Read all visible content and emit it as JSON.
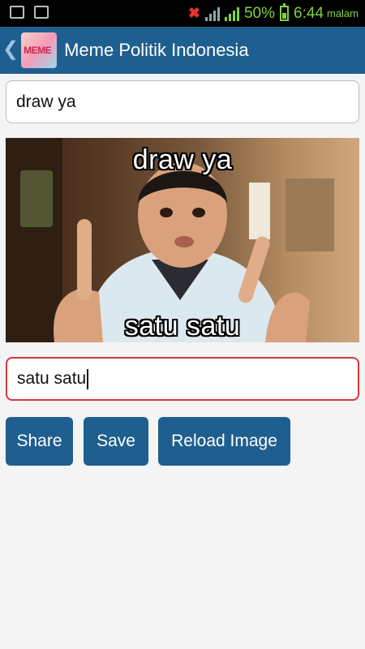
{
  "status_bar": {
    "battery_percent": "50%",
    "time": "6:44",
    "time_suffix": "malam"
  },
  "action_bar": {
    "title": "Meme Politik Indonesia",
    "logo_text": "MEME"
  },
  "top_text": {
    "value": "draw ya"
  },
  "meme": {
    "top_caption": "draw ya",
    "bottom_caption": "satu satu"
  },
  "bottom_text": {
    "value": "satu satu"
  },
  "buttons": {
    "share": "Share",
    "save": "Save",
    "reload": "Reload Image"
  },
  "colors": {
    "action_bar": "#1f5f8f",
    "button": "#1f5f8f",
    "focused_border": "#d9363a",
    "status_accent": "#7fd43a"
  },
  "icons": {
    "status_left": [
      "image-icon",
      "chat-icon"
    ],
    "status_right": [
      "mute-icon",
      "signal-icon",
      "signal-icon",
      "battery-icon"
    ],
    "action_bar": [
      "back-arrow-icon",
      "app-logo"
    ]
  }
}
